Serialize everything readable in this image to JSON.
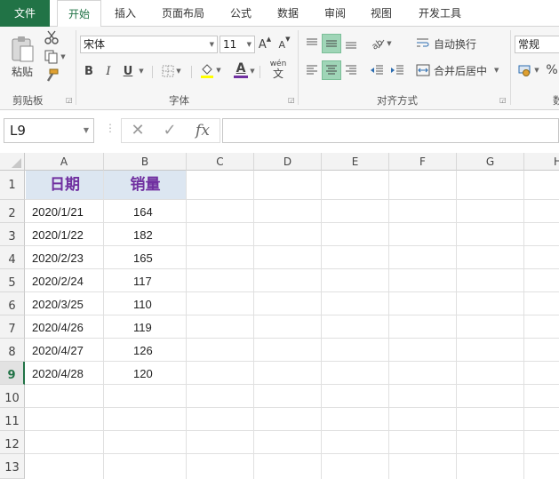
{
  "menu": {
    "tabs": [
      "文件",
      "开始",
      "插入",
      "页面布局",
      "公式",
      "数据",
      "审阅",
      "视图",
      "开发工具"
    ],
    "active_tab": "开始"
  },
  "ribbon": {
    "clipboard": {
      "paste_label": "粘贴",
      "group_label": "剪贴板"
    },
    "font": {
      "font_name": "宋体",
      "font_size": "11",
      "grow_label": "A",
      "shrink_label": "A",
      "bold_label": "B",
      "italic_label": "I",
      "underline_label": "U",
      "font_color_label": "A",
      "phonetic_label": "wén",
      "phonetic_char": "文",
      "group_label": "字体"
    },
    "alignment": {
      "wrap_text_label": "自动换行",
      "merge_center_label": "合并后居中",
      "group_label": "对齐方式"
    },
    "number": {
      "format": "常规",
      "percent_label": "%",
      "group_label_partial": "数"
    },
    "colors": {
      "accent": "#217346",
      "selected_button": "#9fd5b7",
      "font_color_bar": "#7030a0",
      "fill_color_bar": "#ffff00"
    }
  },
  "formula_bar": {
    "name_box": "L9",
    "cancel_symbol": "✕",
    "enter_symbol": "✓",
    "fx_label": "fx",
    "content": ""
  },
  "sheet": {
    "columns": [
      "A",
      "B",
      "C",
      "D",
      "E",
      "F",
      "G",
      "H"
    ],
    "rows": [
      "1",
      "2",
      "3",
      "4",
      "5",
      "6",
      "7",
      "8",
      "9",
      "10",
      "11",
      "12",
      "13"
    ],
    "selected_row": "9",
    "header": {
      "date": "日期",
      "sales": "销量"
    },
    "data": [
      {
        "date": "2020/1/21",
        "sales": "164"
      },
      {
        "date": "2020/1/22",
        "sales": "182"
      },
      {
        "date": "2020/2/23",
        "sales": "165"
      },
      {
        "date": "2020/2/24",
        "sales": "117"
      },
      {
        "date": "2020/3/25",
        "sales": "110"
      },
      {
        "date": "2020/4/26",
        "sales": "119"
      },
      {
        "date": "2020/4/27",
        "sales": "126"
      },
      {
        "date": "2020/4/28",
        "sales": "120"
      }
    ],
    "header_fill": "#dce6f1",
    "header_text_color": "#7030a0"
  }
}
